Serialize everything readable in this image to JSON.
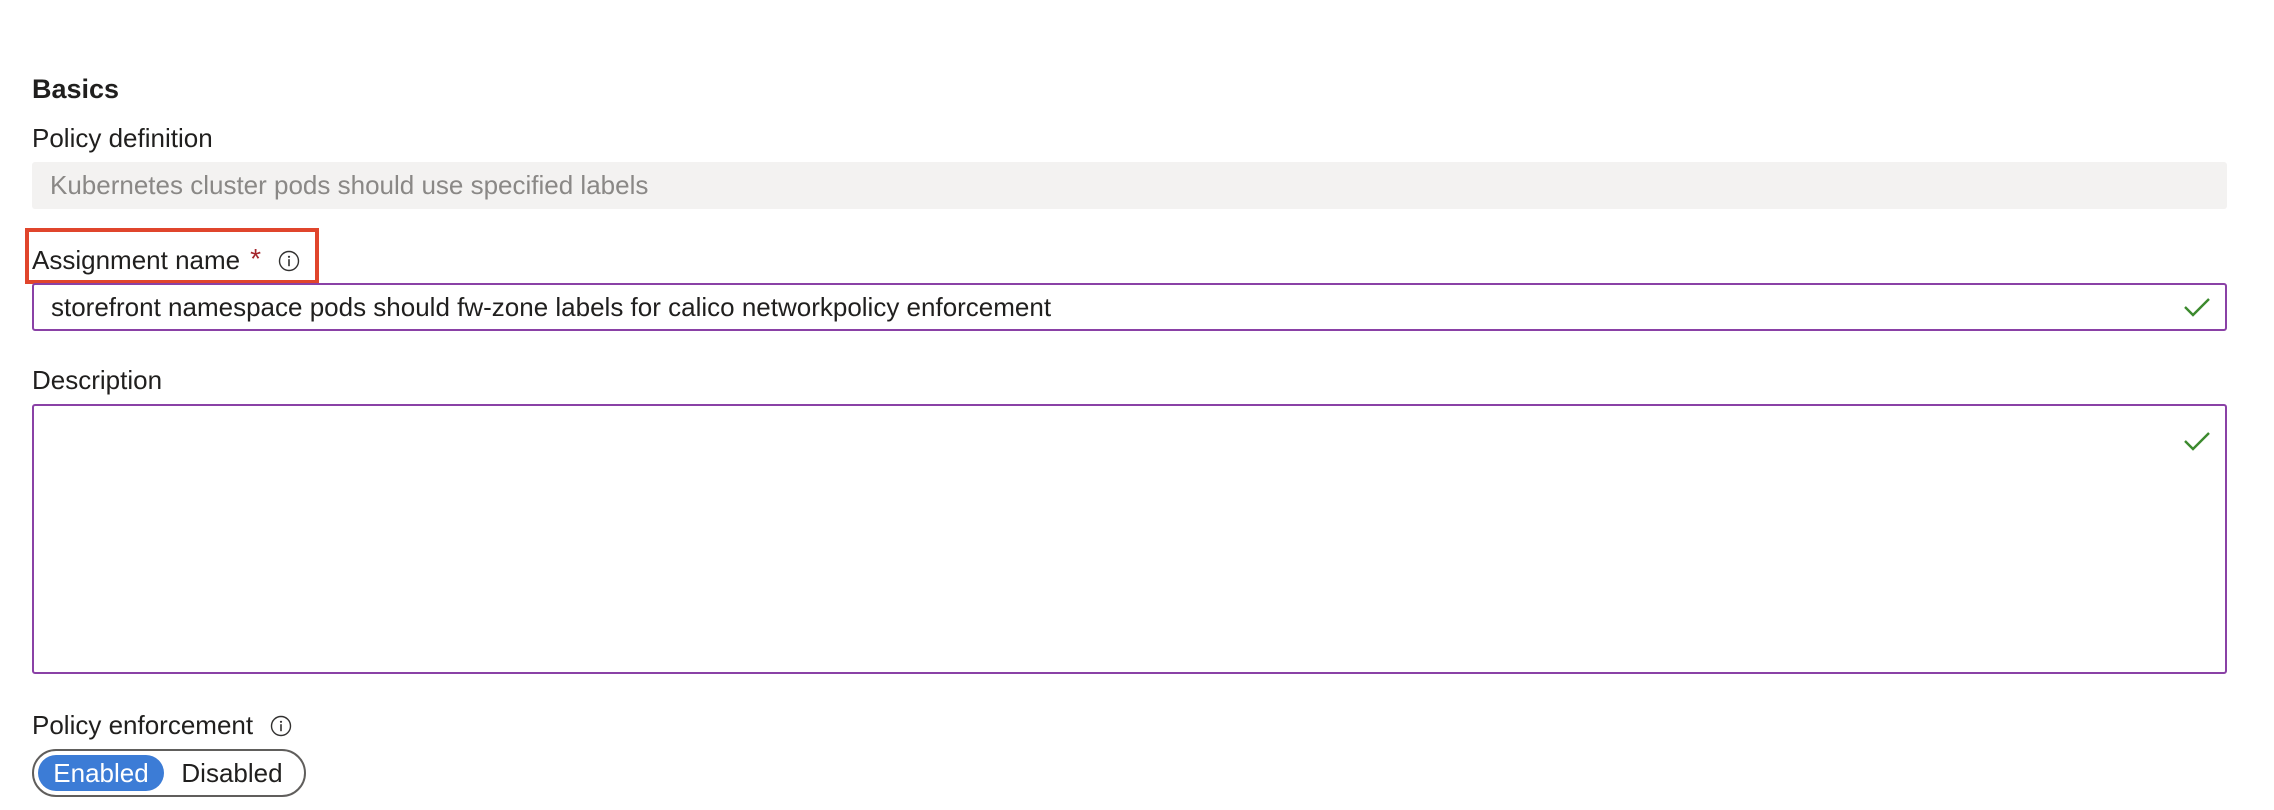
{
  "section": {
    "title": "Basics"
  },
  "policy_definition": {
    "label": "Policy definition",
    "value": "Kubernetes cluster pods should use specified labels"
  },
  "assignment_name": {
    "label": "Assignment name",
    "required_marker": "*",
    "value": "storefront namespace pods should fw-zone labels for calico networkpolicy enforcement"
  },
  "description": {
    "label": "Description",
    "value": ""
  },
  "policy_enforcement": {
    "label": "Policy enforcement",
    "options": [
      "Enabled",
      "Disabled"
    ],
    "selected": "Enabled"
  },
  "colors": {
    "focus_border": "#8a41a6",
    "valid_check": "#3c8a2e",
    "required": "#a4262c",
    "toggle_active": "#3c7cd6",
    "highlight": "#e0452c"
  },
  "icons": {
    "info": "info-icon",
    "valid": "checkmark-icon"
  }
}
